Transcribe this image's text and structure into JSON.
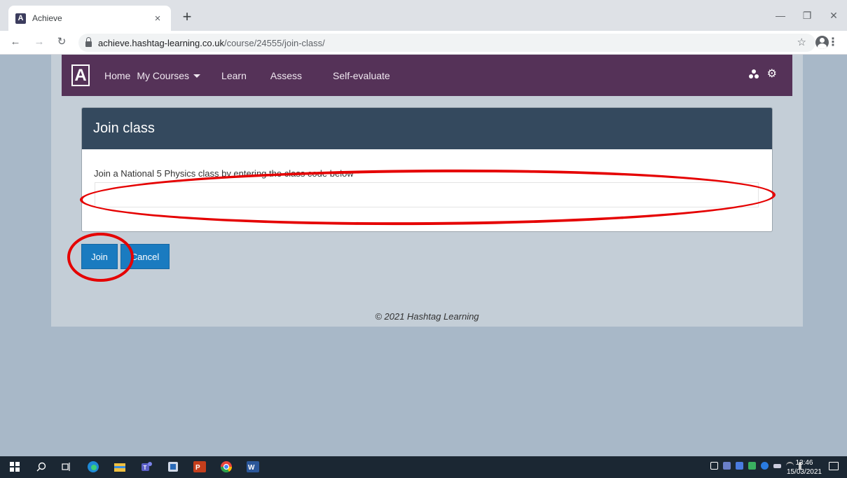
{
  "browser": {
    "tab_title": "Achieve",
    "tab_favicon": "A",
    "tab_close": "×",
    "new_tab": "+",
    "url_host": "achieve.hashtag-learning.co.uk",
    "url_path": "/course/24555/join-class/"
  },
  "navbar": {
    "brand": "A",
    "home": "Home",
    "my_courses": "My Courses",
    "learn": "Learn",
    "assess": "Assess",
    "self_evaluate": "Self-evaluate",
    "right_icons": [
      "trio-icon",
      "gear-icon"
    ]
  },
  "card": {
    "title": "Join class",
    "instruction": "Join a National 5 Physics class by entering the class code below",
    "input_value": ""
  },
  "buttons": {
    "join": "Join",
    "cancel": "Cancel"
  },
  "footer": "© 2021 Hashtag Learning",
  "annotations": {
    "color": "#e50000"
  },
  "taskbar": {
    "apps": [
      "windows-start",
      "search",
      "task-view",
      "edge",
      "file-explorer",
      "teams",
      "photos",
      "powerpoint",
      "chrome",
      "word"
    ],
    "time": "13:46",
    "date": "15/03/2021"
  },
  "colors": {
    "navbar": "#553258",
    "card_header": "#34495e",
    "primary_button": "#1a7bc0",
    "page_bg": "#a8b8c8",
    "container_bg": "#c4ced7"
  }
}
